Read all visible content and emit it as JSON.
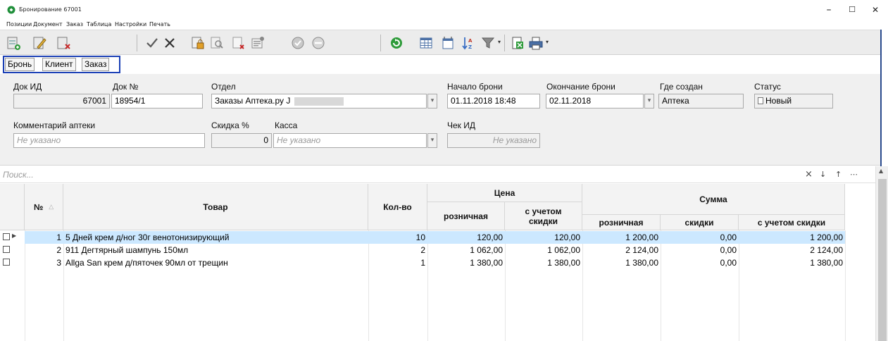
{
  "window": {
    "title": "Бронирование 67001",
    "minimize": "–",
    "maximize": "☐",
    "close": "✕"
  },
  "menu": [
    "Позиции",
    "Документ",
    "Заказ",
    "Таблица",
    "Настройки",
    "Печать"
  ],
  "tabs": [
    "Бронь",
    "Клиент",
    "Заказ"
  ],
  "form": {
    "doc_id": {
      "label": "Док ИД",
      "value": "67001"
    },
    "doc_no": {
      "label": "Док №",
      "value": "18954/1"
    },
    "department": {
      "label": "Отдел",
      "value": "Заказы Аптека.ру J"
    },
    "start": {
      "label": "Начало брони",
      "value": "01.11.2018 18:48"
    },
    "end": {
      "label": "Окончание брони",
      "value": "02.11.2018"
    },
    "created_where": {
      "label": "Где создан",
      "value": "Аптека"
    },
    "status": {
      "label": "Статус",
      "value": "Новый"
    },
    "comment": {
      "label": "Комментарий аптеки",
      "placeholder": "Не указано"
    },
    "discount": {
      "label": "Скидка %",
      "value": "0"
    },
    "cashbox": {
      "label": "Касса",
      "placeholder": "Не указано"
    },
    "check_id": {
      "label": "Чек ИД",
      "placeholder": "Не указано"
    }
  },
  "search": {
    "placeholder": "Поиск...",
    "clear": "×",
    "next": "↓",
    "prev": "↑",
    "more": "⋯"
  },
  "grid": {
    "headers": {
      "no": "№",
      "product": "Товар",
      "qty": "Кол-во",
      "price": "Цена",
      "price_retail": "розничная",
      "price_disc": "с учетом скидки",
      "sum": "Сумма",
      "sum_retail": "розничная",
      "sum_disc_amount": "скидки",
      "sum_with_disc": "с учетом скидки"
    },
    "rows": [
      {
        "no": "1",
        "product": "5 Дней крем д/ног 30г венотонизирующий",
        "qty": "10",
        "price_retail": "120,00",
        "price_disc": "120,00",
        "sum_retail": "1 200,00",
        "sum_discount": "0,00",
        "sum_with_disc": "1 200,00"
      },
      {
        "no": "2",
        "product": "911 Дегтярный шампунь 150мл",
        "qty": "2",
        "price_retail": "1 062,00",
        "price_disc": "1 062,00",
        "sum_retail": "2 124,00",
        "sum_discount": "0,00",
        "sum_with_disc": "2 124,00"
      },
      {
        "no": "3",
        "product": "Allga San крем д/пяточек 90мл от трещин",
        "qty": "1",
        "price_retail": "1 380,00",
        "price_disc": "1 380,00",
        "sum_retail": "1 380,00",
        "sum_discount": "0,00",
        "sum_with_disc": "1 380,00"
      }
    ]
  },
  "colors": {
    "accent_border": "#1a3fb5",
    "selected_row": "#cce8ff",
    "app_icon": "#1f8f3a"
  }
}
